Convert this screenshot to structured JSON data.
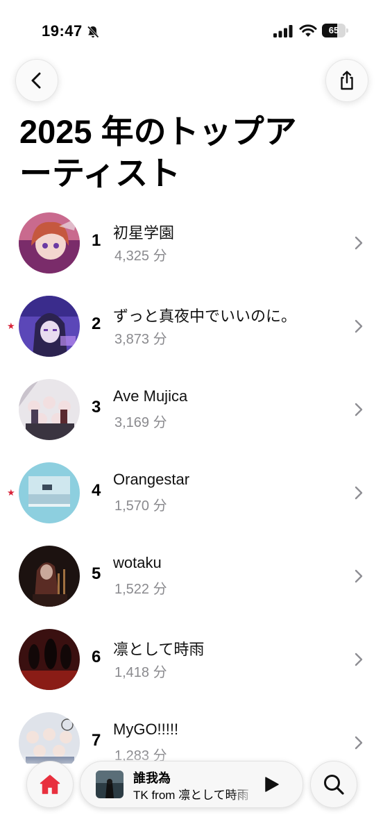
{
  "status_bar": {
    "time": "19:47",
    "battery": "65",
    "battery_level": 0.65
  },
  "page": {
    "title": "2025 年のトップアーティスト"
  },
  "artists": [
    {
      "rank": "1",
      "name": "初星学園",
      "minutes": "4,325 分",
      "starred": false
    },
    {
      "rank": "2",
      "name": "ずっと真夜中でいいのに。",
      "minutes": "3,873 分",
      "starred": true
    },
    {
      "rank": "3",
      "name": "Ave Mujica",
      "minutes": "3,169 分",
      "starred": false
    },
    {
      "rank": "4",
      "name": "Orangestar",
      "minutes": "1,570 分",
      "starred": true
    },
    {
      "rank": "5",
      "name": "wotaku",
      "minutes": "1,522 分",
      "starred": false
    },
    {
      "rank": "6",
      "name": "凛として時雨",
      "minutes": "1,418 分",
      "starred": false
    },
    {
      "rank": "7",
      "name": "MyGO!!!!!",
      "minutes": "1,283 分",
      "starred": false
    }
  ],
  "now_playing": {
    "title": "誰我為",
    "artist": "TK from 凛として時雨"
  },
  "icons": {
    "back": "chevron-left-icon",
    "share": "share-icon",
    "chevron": "chevron-right-icon",
    "star": "star-icon",
    "home": "home-icon",
    "play": "play-icon",
    "search": "search-icon"
  },
  "colors": {
    "accent": "#e8303e",
    "star": "#d8243a",
    "secondary_text": "#8a8a8e"
  }
}
